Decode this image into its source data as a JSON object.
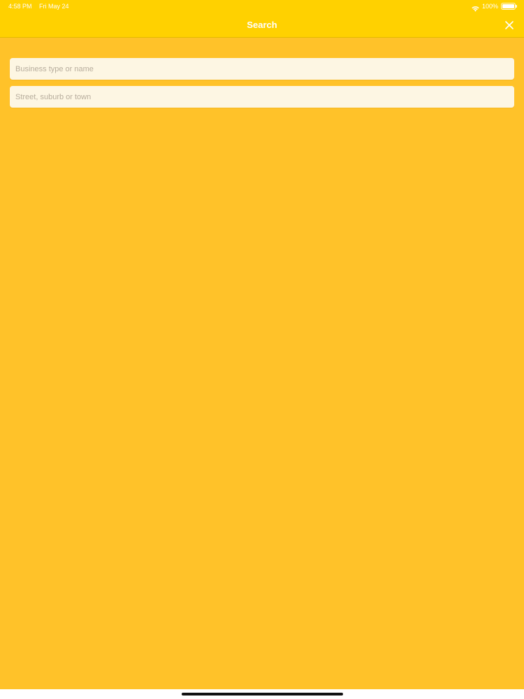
{
  "status_bar": {
    "time": "4:58 PM",
    "date": "Fri May 24",
    "battery_percent": "100%",
    "icons": [
      "wifi-icon",
      "battery-icon"
    ]
  },
  "nav_bar": {
    "title": "Search",
    "close_icon": "close-icon"
  },
  "search": {
    "business_placeholder": "Business type or name",
    "business_value": "",
    "location_placeholder": "Street, suburb or town",
    "location_value": ""
  },
  "colors": {
    "nav_background": "#ffd100",
    "content_background": "#ffc229",
    "field_background": "#fdf6e3",
    "title_text": "#ffffff"
  }
}
